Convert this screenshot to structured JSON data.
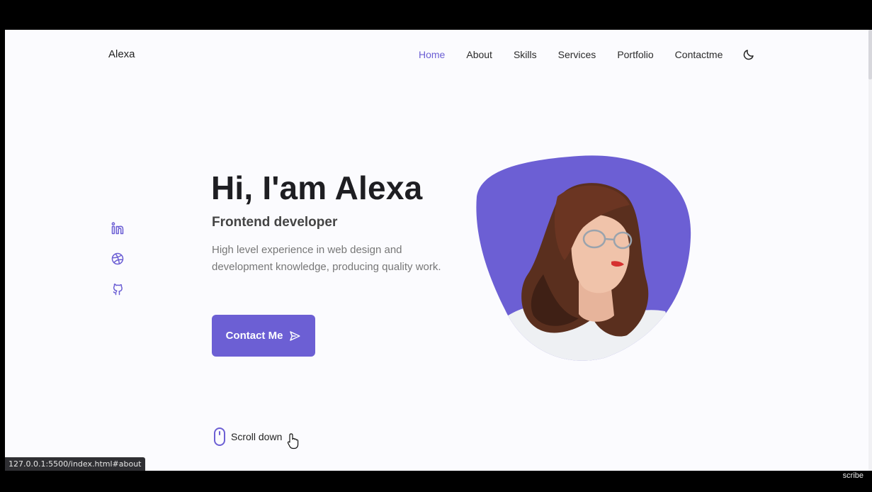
{
  "header": {
    "logo": "Alexa",
    "nav": [
      {
        "label": "Home",
        "active": true
      },
      {
        "label": "About"
      },
      {
        "label": "Skills"
      },
      {
        "label": "Services"
      },
      {
        "label": "Portfolio"
      },
      {
        "label": "Contactme"
      }
    ],
    "theme_toggle_icon": "moon-icon"
  },
  "social": {
    "icons": [
      "linkedin-icon",
      "dribbble-icon",
      "github-icon"
    ],
    "color": "#6c5fd4"
  },
  "hero": {
    "title": "Hi, I'am Alexa",
    "subtitle": "Frontend developer",
    "description": "High level experience in web design and development knowledge, producing quality work.",
    "contact_label": "Contact Me",
    "contact_icon": "send-icon",
    "accent": "#6c5fd4"
  },
  "scroll": {
    "label": "Scroll down",
    "icon": "mouse-icon"
  },
  "status_bar": {
    "url": "127.0.0.1:5500/index.html#about"
  },
  "watermark": "scribe"
}
